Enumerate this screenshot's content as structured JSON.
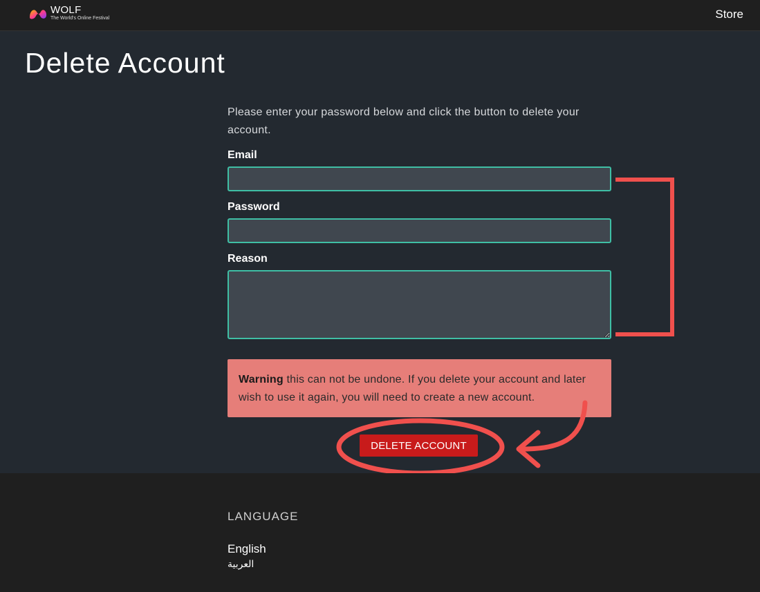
{
  "header": {
    "logo_name": "WOLF",
    "logo_tagline": "The World's Online Festival",
    "store_label": "Store"
  },
  "page": {
    "title": "Delete Account",
    "intro": "Please enter your password below and click the button to delete your account."
  },
  "form": {
    "email_label": "Email",
    "email_value": "",
    "password_label": "Password",
    "password_value": "",
    "reason_label": "Reason",
    "reason_value": ""
  },
  "warning": {
    "strong": "Warning",
    "text": " this can not be undone. If you delete your account and later wish to use it again, you will need to create a new account."
  },
  "delete_button_label": "DELETE ACCOUNT",
  "footer": {
    "language_heading": "LANGUAGE",
    "languages": [
      "English",
      "العربية"
    ]
  },
  "colors": {
    "field_border": "#3fbfa5",
    "warning_bg": "#e67e79",
    "button_bg": "#c81b1b",
    "annotation": "#f0504d"
  }
}
